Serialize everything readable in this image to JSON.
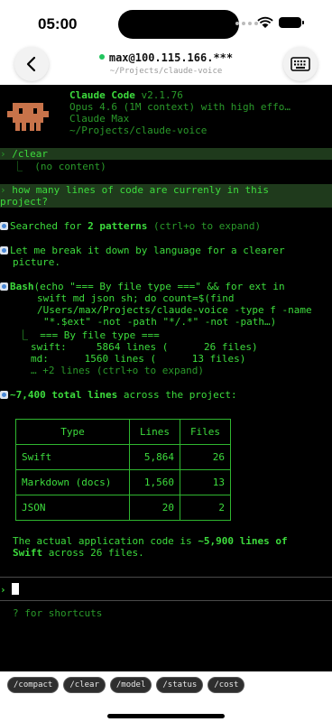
{
  "status_bar": {
    "time": "05:00"
  },
  "header": {
    "host": "max@100.115.166.***",
    "path": "~/Projects/claude-voice",
    "connection_color": "#22c55e"
  },
  "banner": {
    "app_name": "Claude Code",
    "version": "v2.1.76",
    "model": "Opus 4.6 (1M context) with high effo…",
    "plan": "Claude Max",
    "cwd": "~/Projects/claude-voice"
  },
  "transcript": {
    "clear_cmd": "/clear",
    "clear_result": "⎿  (no content)",
    "question_line1": "how many lines of code are currenly in this",
    "question_line2": "project?",
    "search_pre": "Searched for ",
    "search_count": "2 patterns",
    "search_hint": " (ctrl+o to expand)",
    "breakdown_line1": "Let me break it down by language for a clearer",
    "breakdown_line2": "picture.",
    "bash_label": "Bash",
    "bash_cmd1": "(echo \"=== By file type ===\" && for ext in",
    "bash_cmd2": "swift md json sh; do count=$(find",
    "bash_cmd3": "/Users/max/Projects/claude-voice -type f -name",
    "bash_cmd4": "\"*.$ext\" -not -path \"*/.*\" -not -path…)",
    "out1": "⎿  === By file type ===",
    "out2": "swift:     5864 lines (      26 files)",
    "out3": "md:      1560 lines (      13 files)",
    "out4": "… +2 lines (ctrl+o to expand)",
    "total_value": "~7,400 total lines",
    "total_rest": " across the project:",
    "table": {
      "headers": [
        "Type",
        "Lines",
        "Files"
      ],
      "rows": [
        [
          "Swift",
          "5,864",
          "26"
        ],
        [
          "Markdown (docs)",
          "1,560",
          "13"
        ],
        [
          "JSON",
          "20",
          "2"
        ]
      ]
    },
    "summary_pre": "The actual application code is ",
    "summary_bold1": "~5,900 lines of",
    "summary_bold2": "Swift",
    "summary_post": " across 26 files."
  },
  "prompt": {
    "symbol": "›",
    "hint": "? for shortcuts"
  },
  "quick_commands": [
    "/compact",
    "/clear",
    "/model",
    "/status",
    "/cost"
  ],
  "colors": {
    "terminal_fg": "#3ddc3d",
    "terminal_bg": "#000000",
    "highlight_bg": "#1f3a1c",
    "mascot": "#c8734a"
  }
}
